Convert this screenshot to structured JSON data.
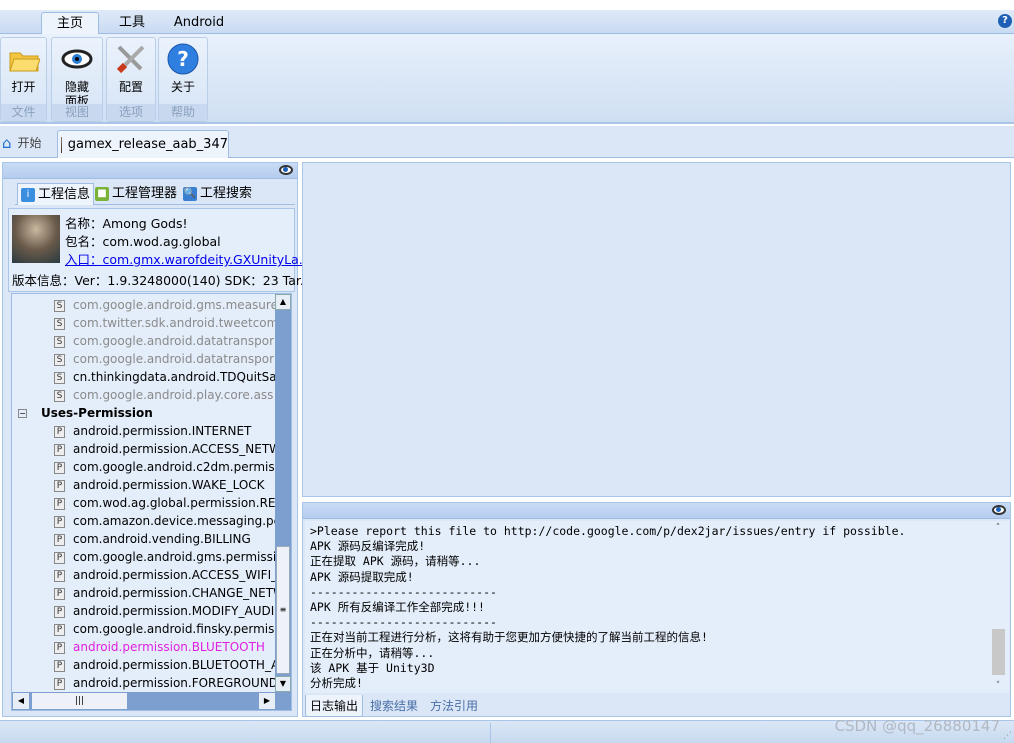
{
  "ribbon": {
    "tabs": [
      "主页",
      "工具",
      "Android"
    ],
    "active_tab": "主页",
    "groups": [
      {
        "button": "打开",
        "label": "文件",
        "icon": "folder-icon"
      },
      {
        "button": "隐藏面板",
        "label": "视图",
        "icon": "eye-icon"
      },
      {
        "button": "配置",
        "label": "选项",
        "icon": "tools-icon"
      },
      {
        "button": "关于",
        "label": "帮助",
        "icon": "help-icon"
      }
    ]
  },
  "doc_tabs": [
    {
      "label": "开始",
      "icon": "home-icon"
    },
    {
      "label": "gamex_release_aab_347",
      "icon": "app-icon",
      "active": true
    }
  ],
  "left_panel": {
    "tabs": [
      "工程信息",
      "工程管理器",
      "工程搜索"
    ],
    "info": {
      "name": "名称：Among Gods!",
      "package": "包名：com.wod.ag.global",
      "entry": "入口：com.gmx.warofdeity.GXUnityLa...",
      "version": "版本信息：Ver：1.9.3248000(140) SDK：23 Tar..."
    },
    "tree": {
      "services": [
        {
          "text": "com.google.android.gms.measure",
          "disabled": true
        },
        {
          "text": "com.twitter.sdk.android.tweetcomp",
          "disabled": true
        },
        {
          "text": "com.google.android.datatranspor",
          "disabled": true
        },
        {
          "text": "com.google.android.datatranspor",
          "disabled": true
        },
        {
          "text": "cn.thinkingdata.android.TDQuitSaf",
          "disabled": false
        },
        {
          "text": "com.google.android.play.core.ass",
          "disabled": true
        }
      ],
      "permission_group": "Uses-Permission",
      "permissions": [
        {
          "text": "android.permission.INTERNET"
        },
        {
          "text": "android.permission.ACCESS_NETW"
        },
        {
          "text": "com.google.android.c2dm.permis"
        },
        {
          "text": "android.permission.WAKE_LOCK"
        },
        {
          "text": "com.wod.ag.global.permission.RE("
        },
        {
          "text": "com.amazon.device.messaging.pe"
        },
        {
          "text": "com.android.vending.BILLING"
        },
        {
          "text": "com.google.android.gms.permissi"
        },
        {
          "text": "android.permission.ACCESS_WIFI_"
        },
        {
          "text": "android.permission.CHANGE_NETW"
        },
        {
          "text": "android.permission.MODIFY_AUDI"
        },
        {
          "text": "com.google.android.finsky.permis"
        },
        {
          "text": "android.permission.BLUETOOTH",
          "highlight": true
        },
        {
          "text": "android.permission.BLUETOOTH_A"
        },
        {
          "text": "android.permission.FOREGROUND"
        }
      ]
    }
  },
  "log": {
    "lines": [
      ">Please report this file to http://code.google.com/p/dex2jar/issues/entry if possible.",
      "APK 源码反编译完成!",
      "正在提取 APK 源码，请稍等...",
      "APK 源码提取完成!",
      "---------------------------",
      "APK 所有反编译工作全部完成!!!",
      "---------------------------",
      "正在对当前工程进行分析，这将有助于您更加方便快捷的了解当前工程的信息!",
      "正在分析中，请稍等...",
      "该 APK 基于 Unity3D",
      "分析完成!"
    ],
    "tabs": [
      "日志输出",
      "搜索结果",
      "方法引用"
    ],
    "active_tab": "日志输出"
  },
  "watermark": "CSDN @qq_26880147",
  "colors": {
    "highlight": "#e020e0",
    "disabled": "#8a8a8a",
    "link": "#0000ee"
  }
}
